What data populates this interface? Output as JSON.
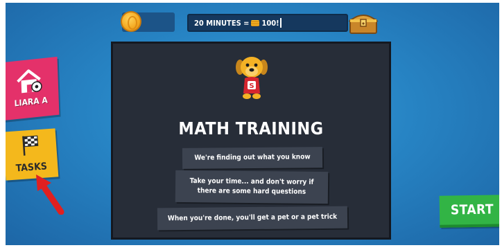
{
  "hud": {
    "coin_icon": "coin-icon",
    "progress_text_prefix": "20 MINUTES =",
    "progress_text_suffix": "100!",
    "progress_fraction": 0.0,
    "chest_icon": "treasure-chest-icon"
  },
  "sidebar": {
    "home_label": "LIARA A",
    "home_icon": "house-icon",
    "tasks_label": "TASKS",
    "tasks_icon": "checkered-flag-icon"
  },
  "panel": {
    "mascot_icon": "dog-mascot-icon",
    "title": "MATH TRAINING",
    "messages": [
      "We're finding out what you know",
      "Take your time... and don't worry if there are some hard questions",
      "When you're done, you'll get a pet or a pet trick"
    ]
  },
  "start_button": {
    "label": "START"
  },
  "colors": {
    "background": "#2784c4",
    "panel": "#272d38",
    "home_button": "#e4316a",
    "tasks_button": "#f4b81c",
    "start_button": "#32b445",
    "annotation_arrow": "#e02020"
  }
}
